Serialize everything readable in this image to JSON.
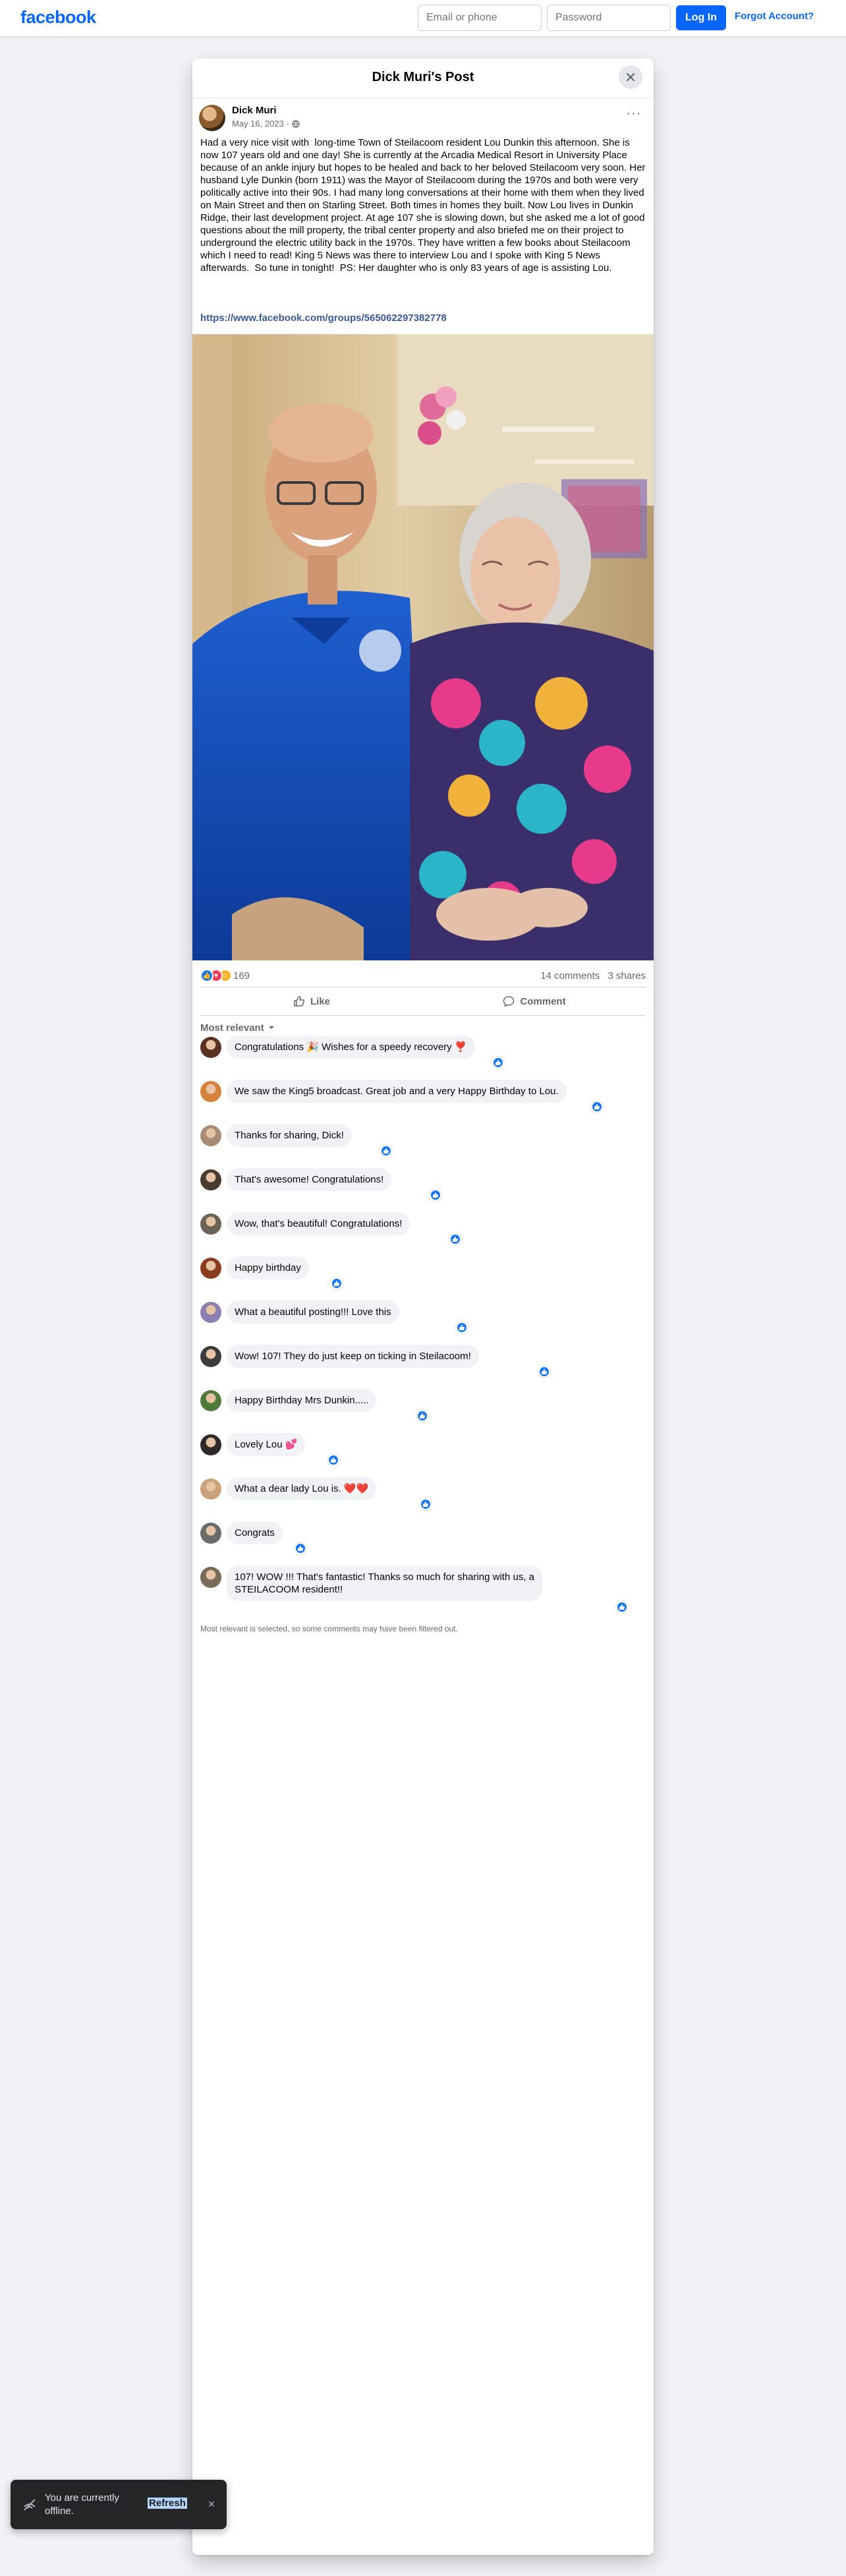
{
  "topbar": {
    "logo": "facebook",
    "email_placeholder": "Email or phone",
    "password_placeholder": "Password",
    "login_label": "Log In",
    "forgot_label": "Forgot Account?"
  },
  "dialog": {
    "title": "Dick Muri's Post",
    "close_icon": "close-icon"
  },
  "post": {
    "author": "Dick Muri",
    "date": "May 16, 2023",
    "separator": "·",
    "privacy_icon": "globe-icon",
    "more_label": "···",
    "text": "Had a very nice visit with  long-time Town of Steilacoom resident Lou Dunkin this afternoon. She is now 107 years old and one day! She is currently at the Arcadia Medical Resort in University Place because of an ankle injury but hopes to be healed and back to her beloved Steilacoom very soon. Her husband Lyle Dunkin (born 1911) was the Mayor of Steilacoom during the 1970s and both were very politically active into their 90s. I had many long conversations at their home with them when they lived on Main Street and then on Starling Street. Both times in homes they built. Now Lou lives in Dunkin Ridge, their last development project. At age 107 she is slowing down, but she asked me a lot of good questions about the mill property, the tribal center property and also briefed me on their project to underground the electric utility back in the 1970s. They have written a few books about Steilacoom which I need to read! King 5 News was there to interview Lou and I spoke with King 5 News afterwards.  So tune in tonight!  PS: Her daughter who is only 83 years of age is assisting Lou.",
    "link": "https://www.facebook.com/groups/565062297382778",
    "reaction_count": "169",
    "comments_count": "14 comments",
    "shares_count": "3 shares",
    "like_label": "Like",
    "comment_label": "Comment",
    "sort_label": "Most relevant",
    "accent": "#0866ff",
    "like_color": "#1877f2",
    "love_color": "#f33e58",
    "care_color": "#f7b125"
  },
  "comments": [
    {
      "text": "Congratulations 🎉 Wishes for a speedy recovery ❣️",
      "avatar_color": "#5a3222"
    },
    {
      "text": "We saw the King5 broadcast. Great job and a very Happy Birthday to Lou.",
      "avatar_color": "#d4813a"
    },
    {
      "text": "Thanks for sharing, Dick!",
      "avatar_color": "#a88b73"
    },
    {
      "text": "That's awesome! Congratulations!",
      "avatar_color": "#4a3b30"
    },
    {
      "text": "Wow, that's beautiful! Congratulations!",
      "avatar_color": "#6c6258"
    },
    {
      "text": "Happy birthday",
      "avatar_color": "#8a3c1c"
    },
    {
      "text": "What a beautiful posting!!! Love this",
      "avatar_color": "#8a7fb0"
    },
    {
      "text": "Wow! 107! They do just keep on ticking in Steilacoom!",
      "avatar_color": "#3b3b3b"
    },
    {
      "text": "Happy Birthday Mrs Dunkin.....",
      "avatar_color": "#4f7a3a"
    },
    {
      "text": "Lovely Lou 💕",
      "avatar_color": "#2e2a28"
    },
    {
      "text": "What a dear lady Lou is. ❤️❤️",
      "avatar_color": "#c9a27a"
    },
    {
      "text": "Congrats",
      "avatar_color": "#6b6b6b"
    },
    {
      "text": "107! WOW !!! That's fantastic! Thanks so much for sharing with us, a",
      "text2": "STEILACOOM resident!!",
      "avatar_color": "#7a6a5a"
    }
  ],
  "filter_note": "Most relevant is selected, so some comments may have been filtered out.",
  "toast": {
    "text": "You are currently offline.",
    "refresh_label": "Refresh",
    "icon": "offline-icon"
  }
}
